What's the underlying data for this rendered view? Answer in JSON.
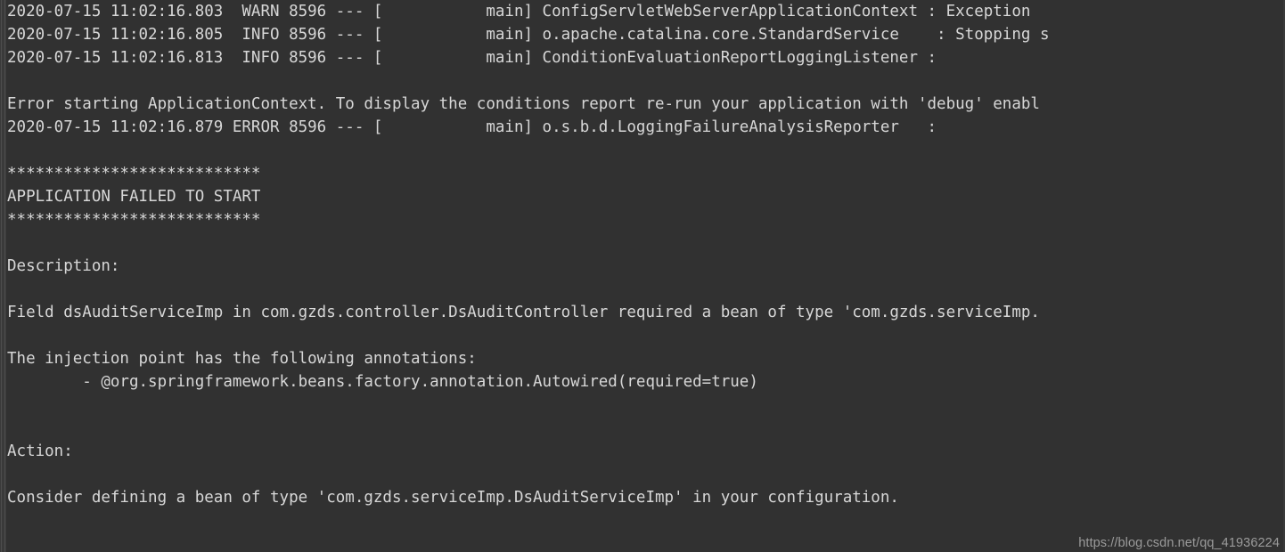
{
  "console": {
    "title": "Spring Boot Application Console",
    "background_color": "#313131",
    "text_color": "#d7d7d7",
    "gutter_color": "#3a3a3a",
    "lines": [
      "2020-07-15 11:02:16.803  WARN 8596 --- [           main] ConfigServletWebServerApplicationContext : Exception",
      "2020-07-15 11:02:16.805  INFO 8596 --- [           main] o.apache.catalina.core.StandardService    : Stopping s",
      "2020-07-15 11:02:16.813  INFO 8596 --- [           main] ConditionEvaluationReportLoggingListener :",
      "",
      "Error starting ApplicationContext. To display the conditions report re-run your application with 'debug' enabl",
      "2020-07-15 11:02:16.879 ERROR 8596 --- [           main] o.s.b.d.LoggingFailureAnalysisReporter   :",
      "",
      "***************************",
      "APPLICATION FAILED TO START",
      "***************************",
      "",
      "Description:",
      "",
      "Field dsAuditServiceImp in com.gzds.controller.DsAuditController required a bean of type 'com.gzds.serviceImp.",
      "",
      "The injection point has the following annotations:",
      "        - @org.springframework.beans.factory.annotation.Autowired(required=true)",
      "",
      "",
      "Action:",
      "",
      "Consider defining a bean of type 'com.gzds.serviceImp.DsAuditServiceImp' in your configuration.",
      ""
    ]
  },
  "watermark": {
    "text": "https://blog.csdn.net/qq_41936224"
  }
}
